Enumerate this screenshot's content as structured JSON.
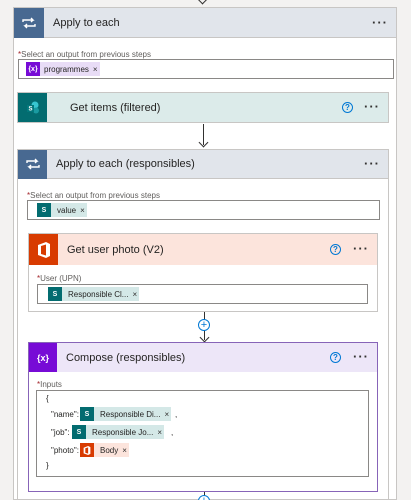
{
  "apply_each_1": {
    "title": "Apply to each",
    "menu": "···"
  },
  "select_output_label": "Select an output from previous steps",
  "programmes_token": {
    "label": "programmes",
    "icon": "{x}"
  },
  "get_items": {
    "title": "Get items (filtered)",
    "help": "?",
    "menu": "···"
  },
  "apply_each_2": {
    "title": "Apply to each (responsibles)",
    "menu": "···"
  },
  "value_token": {
    "label": "value"
  },
  "get_photo": {
    "title": "Get user photo (V2)",
    "help": "?",
    "menu": "···"
  },
  "user_upn_label": "User (UPN)",
  "responsible_token": {
    "label": "Responsible Cl..."
  },
  "compose": {
    "title": "Compose (responsibles)",
    "help": "?",
    "menu": "···"
  },
  "inputs_label": "Inputs",
  "json_open": "{",
  "json_close": "}",
  "name_key": "\"name\":",
  "name_token": "Responsible Di...",
  "job_key": "\"job\":",
  "job_token": "Responsible Jo...",
  "photo_key": "\"photo\":",
  "photo_token": "Body",
  "comma": ",",
  "remove": "×",
  "req": "*",
  "colors": {
    "loop": "#486991",
    "sharepoint": "#036c70",
    "office": "#d83b01",
    "variable": "#770bd6",
    "compose_bg": "#ede6f8",
    "photo_bg": "#fce4dc",
    "sp_bg": "#dcebea"
  },
  "icons": [
    "loop-icon",
    "sharepoint-icon",
    "office-icon",
    "variable-icon",
    "help-icon",
    "more-icon",
    "plus-icon",
    "down-arrow-icon",
    "close-icon"
  ]
}
